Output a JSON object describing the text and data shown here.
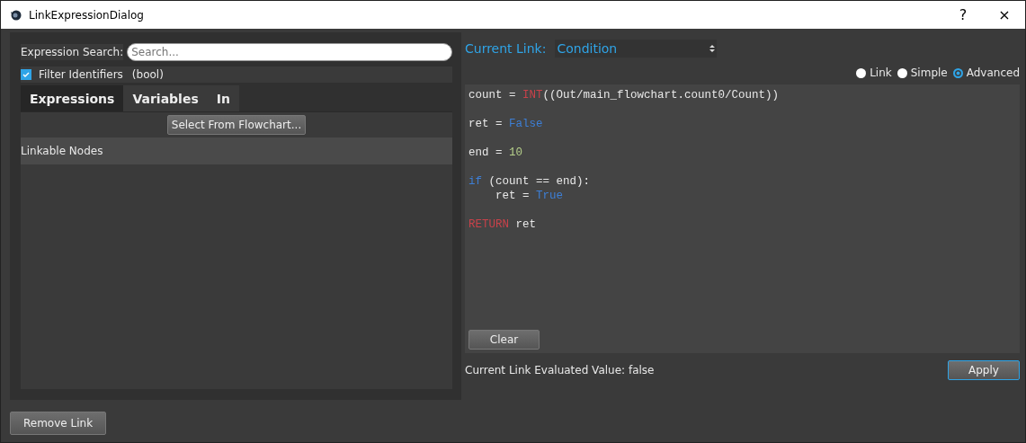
{
  "window": {
    "title": "LinkExpressionDialog",
    "buttons": [
      "?",
      "×"
    ]
  },
  "left": {
    "search_label": "Expression Search:",
    "search": {
      "placeholder": "Search..."
    },
    "filter": {
      "label": "Filter Identifiers",
      "checked": true,
      "type": "(bool)"
    },
    "tabs": [
      {
        "label": "Expressions",
        "selected": true
      },
      {
        "label": "Variables",
        "selected": false
      },
      {
        "label": "In",
        "selected": false
      }
    ],
    "select_button": "Select From Flowchart...",
    "list_header": "Linkable Nodes"
  },
  "right": {
    "current_link_label": "Current Link:",
    "current_link": "Condition",
    "modes": [
      {
        "label": "Link",
        "selected": false
      },
      {
        "label": "Simple",
        "selected": false
      },
      {
        "label": "Advanced",
        "selected": true
      }
    ],
    "code": [
      {
        "lines": [
          [
            {
              "text": "count = ",
              "kind": "plain"
            },
            {
              "text": "INT",
              "kind": "builtin"
            },
            {
              "text": "((Out/main_flowchart.count0/Count))",
              "kind": "plain"
            }
          ]
        ]
      },
      {
        "lines": [
          [
            {
              "text": "ret = ",
              "kind": "plain"
            },
            {
              "text": "False",
              "kind": "keyword"
            }
          ]
        ]
      },
      {
        "lines": [
          [
            {
              "text": "end = ",
              "kind": "plain"
            },
            {
              "text": "10",
              "kind": "number"
            }
          ]
        ]
      },
      {
        "lines": [
          [
            {
              "text": "if",
              "kind": "keyword"
            },
            {
              "text": " (count == end):",
              "kind": "plain"
            }
          ],
          [
            {
              "text": "    ret = ",
              "kind": "plain"
            },
            {
              "text": "True",
              "kind": "keyword"
            }
          ]
        ]
      },
      {
        "lines": [
          [
            {
              "text": "RETURN",
              "kind": "builtin"
            },
            {
              "text": " ret",
              "kind": "plain"
            }
          ]
        ]
      }
    ],
    "clear_button": "Clear",
    "evaluated": "Current Link Evaluated Value: false",
    "apply_button": "Apply"
  },
  "remove_button": "Remove Link"
}
